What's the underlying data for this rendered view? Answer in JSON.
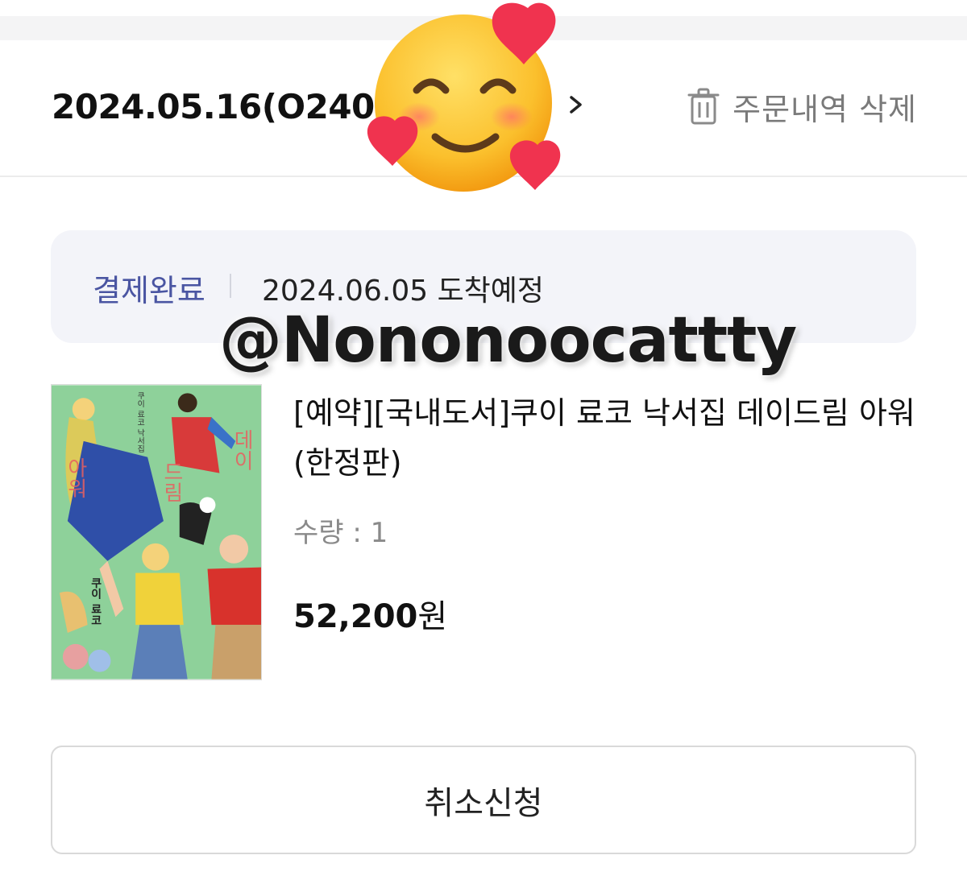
{
  "order": {
    "title": "2024.05.16(O2405",
    "delete_label": "주문내역 삭제"
  },
  "status": {
    "label": "결제완료",
    "arrival": "2024.06.05 도착예정"
  },
  "watermark": "@Nononoocattty",
  "product": {
    "title": "[예약][국내도서]쿠이 료코 낙서집 데이드림 아워(한정판)",
    "quantity": "수량 : 1",
    "price_amount": "52,200",
    "price_unit": "원",
    "cover_title": "데이드림 아워",
    "cover_author": "쿠이 료코"
  },
  "actions": {
    "cancel_label": "취소신청"
  },
  "colors": {
    "status_accent": "#4a55a2",
    "status_bg": "#f3f4f9",
    "cover_bg": "#8ed19a"
  }
}
